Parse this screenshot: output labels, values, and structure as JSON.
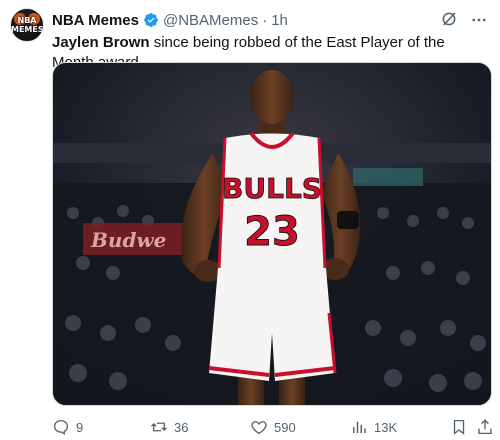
{
  "colors": {
    "verified": "#1d9bf0",
    "text_primary": "#0f1419",
    "text_secondary": "#536471",
    "jersey_red": "#c8102e"
  },
  "author": {
    "display_name": "NBA Memes",
    "handle": "@NBAMemes",
    "separator": "·",
    "time": "1h",
    "avatar_text_1": "NBA",
    "avatar_text_2": "MEMES",
    "verified_icon": "verified-badge-icon"
  },
  "tweet": {
    "bold_text": "Jaylen Brown",
    "rest_text": " since being robbed of the East Player of the Month award"
  },
  "media": {
    "jersey_team": "BULLS",
    "jersey_number": "23",
    "banner_text": "Budwe"
  },
  "actions": {
    "replies": "9",
    "reposts": "36",
    "likes": "590",
    "views": "13K"
  }
}
